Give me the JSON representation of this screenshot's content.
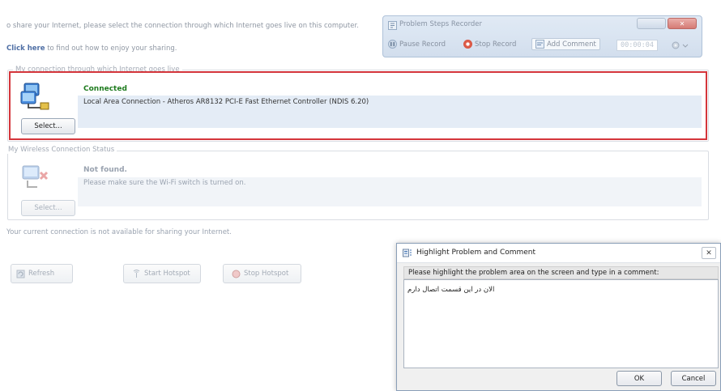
{
  "intro": {
    "line1": "o share your Internet, please select the connection through which Internet goes live on this computer.",
    "click_here": "Click here",
    "line2_rest": " to find out how to enjoy your sharing."
  },
  "internet_group": {
    "legend": "My connection through which Internet goes live",
    "status": "Connected",
    "connection_name": "Local Area Connection - Atheros AR8132 PCI-E Fast Ethernet Controller (NDIS 6.20)",
    "select_label": "Select..."
  },
  "wireless_group": {
    "legend": "My Wireless Connection Status",
    "status": "Not found.",
    "message": "Please make sure the Wi-Fi switch is turned on.",
    "select_label": "Select..."
  },
  "availability_text": "Your current connection is not available for sharing your Internet.",
  "actions": {
    "refresh": "Refresh",
    "start_hotspot": "Start Hotspot",
    "stop_hotspot": "Stop Hotspot"
  },
  "psr": {
    "title": "Problem Steps Recorder",
    "pause": "Pause Record",
    "stop": "Stop Record",
    "add_comment": "Add Comment",
    "timer": "00:00:04"
  },
  "dialog": {
    "title": "Highlight Problem and Comment",
    "prompt": "Please highlight the problem area on the screen and type in a comment:",
    "comment": "الان در این قسمت اتصال دارم",
    "ok": "OK",
    "cancel": "Cancel"
  },
  "colors": {
    "highlight_border": "#d4353b",
    "connected_green": "#1e7b1e",
    "link_blue": "#4f6fa5"
  }
}
